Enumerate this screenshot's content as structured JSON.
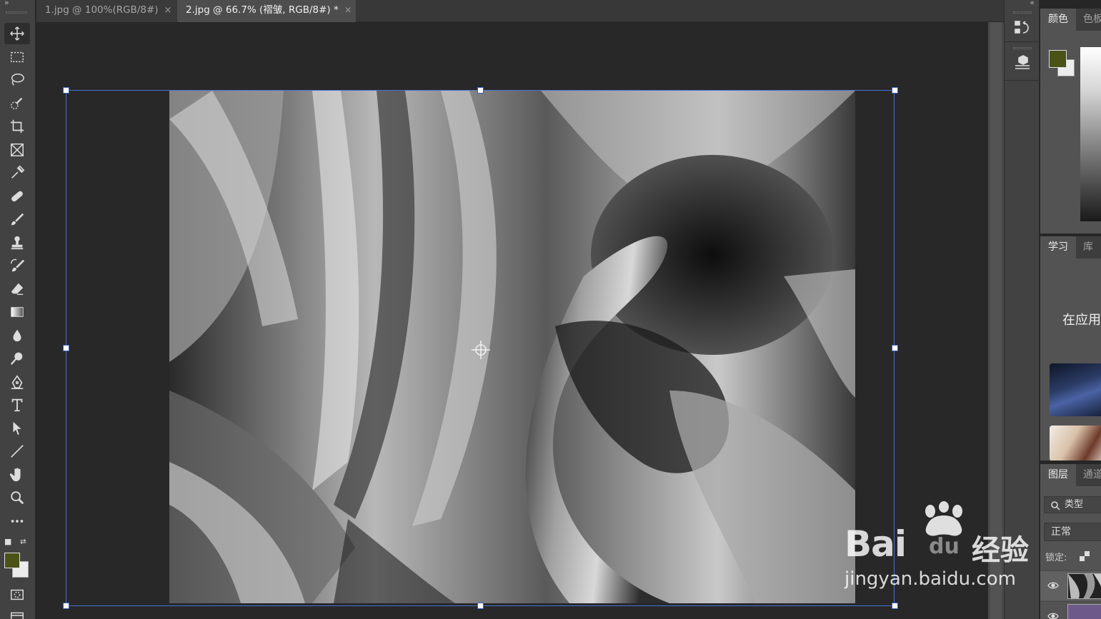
{
  "tabs": [
    {
      "label": "1.jpg @ 100%(RGB/8#)",
      "active": false
    },
    {
      "label": "2.jpg @ 66.7% (褶皱, RGB/8#) *",
      "active": true
    }
  ],
  "tab_close_glyph": "×",
  "toolbar": {
    "tools": [
      {
        "name": "move-tool",
        "icon": "move-icon",
        "active": true
      },
      {
        "name": "rectangular-marquee-tool",
        "icon": "marquee-icon"
      },
      {
        "name": "lasso-tool",
        "icon": "lasso-icon"
      },
      {
        "name": "quick-selection-tool",
        "icon": "quick-selection-icon"
      },
      {
        "name": "crop-tool",
        "icon": "crop-icon"
      },
      {
        "name": "frame-tool",
        "icon": "frame-icon"
      },
      {
        "name": "eyedropper-tool",
        "icon": "eyedropper-icon"
      },
      {
        "name": "healing-brush-tool",
        "icon": "bandage-icon"
      },
      {
        "name": "brush-tool",
        "icon": "brush-icon"
      },
      {
        "name": "clone-stamp-tool",
        "icon": "stamp-icon"
      },
      {
        "name": "history-brush-tool",
        "icon": "history-brush-icon"
      },
      {
        "name": "eraser-tool",
        "icon": "eraser-icon"
      },
      {
        "name": "gradient-tool",
        "icon": "gradient-icon"
      },
      {
        "name": "blur-tool",
        "icon": "drop-icon"
      },
      {
        "name": "dodge-tool",
        "icon": "dodge-icon"
      },
      {
        "name": "pen-tool",
        "icon": "pen-icon"
      },
      {
        "name": "type-tool",
        "icon": "type-icon"
      },
      {
        "name": "path-selection-tool",
        "icon": "arrow-icon"
      },
      {
        "name": "line-tool",
        "icon": "line-icon"
      },
      {
        "name": "hand-tool",
        "icon": "hand-icon"
      },
      {
        "name": "zoom-tool",
        "icon": "zoom-icon"
      },
      {
        "name": "edit-toolbar",
        "icon": "more-icon"
      }
    ],
    "foreground_color": "#4a5218",
    "background_color": "#ececec"
  },
  "panels": {
    "color": {
      "tabs": [
        "颜色",
        "色板"
      ],
      "foreground_color": "#4a5218",
      "background_color": "#ececec"
    },
    "learn": {
      "tabs": [
        "学习",
        "库"
      ],
      "heading": "在应用"
    },
    "layers": {
      "tabs": [
        "图层",
        "通道"
      ],
      "search_placeholder": "类型",
      "blend_mode": "正常",
      "lock_label": "锁定:"
    }
  },
  "watermark": {
    "brand": "Bai",
    "brand_suffix": "du",
    "cn": "经验",
    "url": "jingyan.baidu.com"
  }
}
